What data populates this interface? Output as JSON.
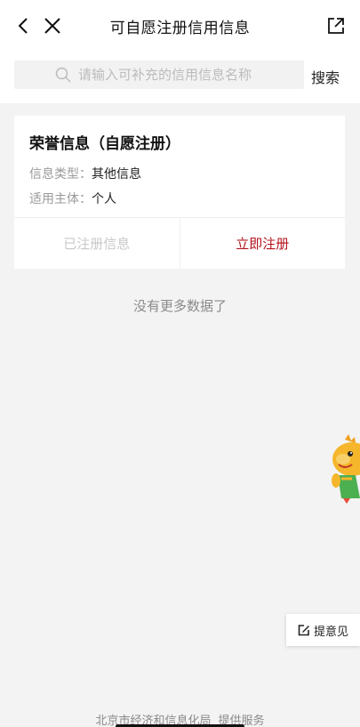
{
  "header": {
    "title": "可自愿注册信用信息",
    "back_icon": "chevron-left-icon",
    "close_icon": "close-icon",
    "share_icon": "share-external-icon"
  },
  "search": {
    "placeholder": "请输入可补充的信用信息名称",
    "value": "",
    "button_label": "搜索",
    "icon": "search-icon"
  },
  "card": {
    "title": "荣誉信息（自愿注册）",
    "fields": [
      {
        "label": "信息类型：",
        "value": "其他信息"
      },
      {
        "label": "适用主体：",
        "value": "个人"
      }
    ],
    "actions": {
      "registered_label": "已注册信息",
      "register_label": "立即注册"
    }
  },
  "list_status": "没有更多数据了",
  "feedback": {
    "label": "提意见",
    "icon": "edit-icon"
  },
  "footer": {
    "org": "北京市经济和信息化局",
    "service": "提供服务"
  },
  "colors": {
    "accent": "#b4141e",
    "background": "#f3f3f3",
    "disabled_text": "#c8c8c8"
  }
}
